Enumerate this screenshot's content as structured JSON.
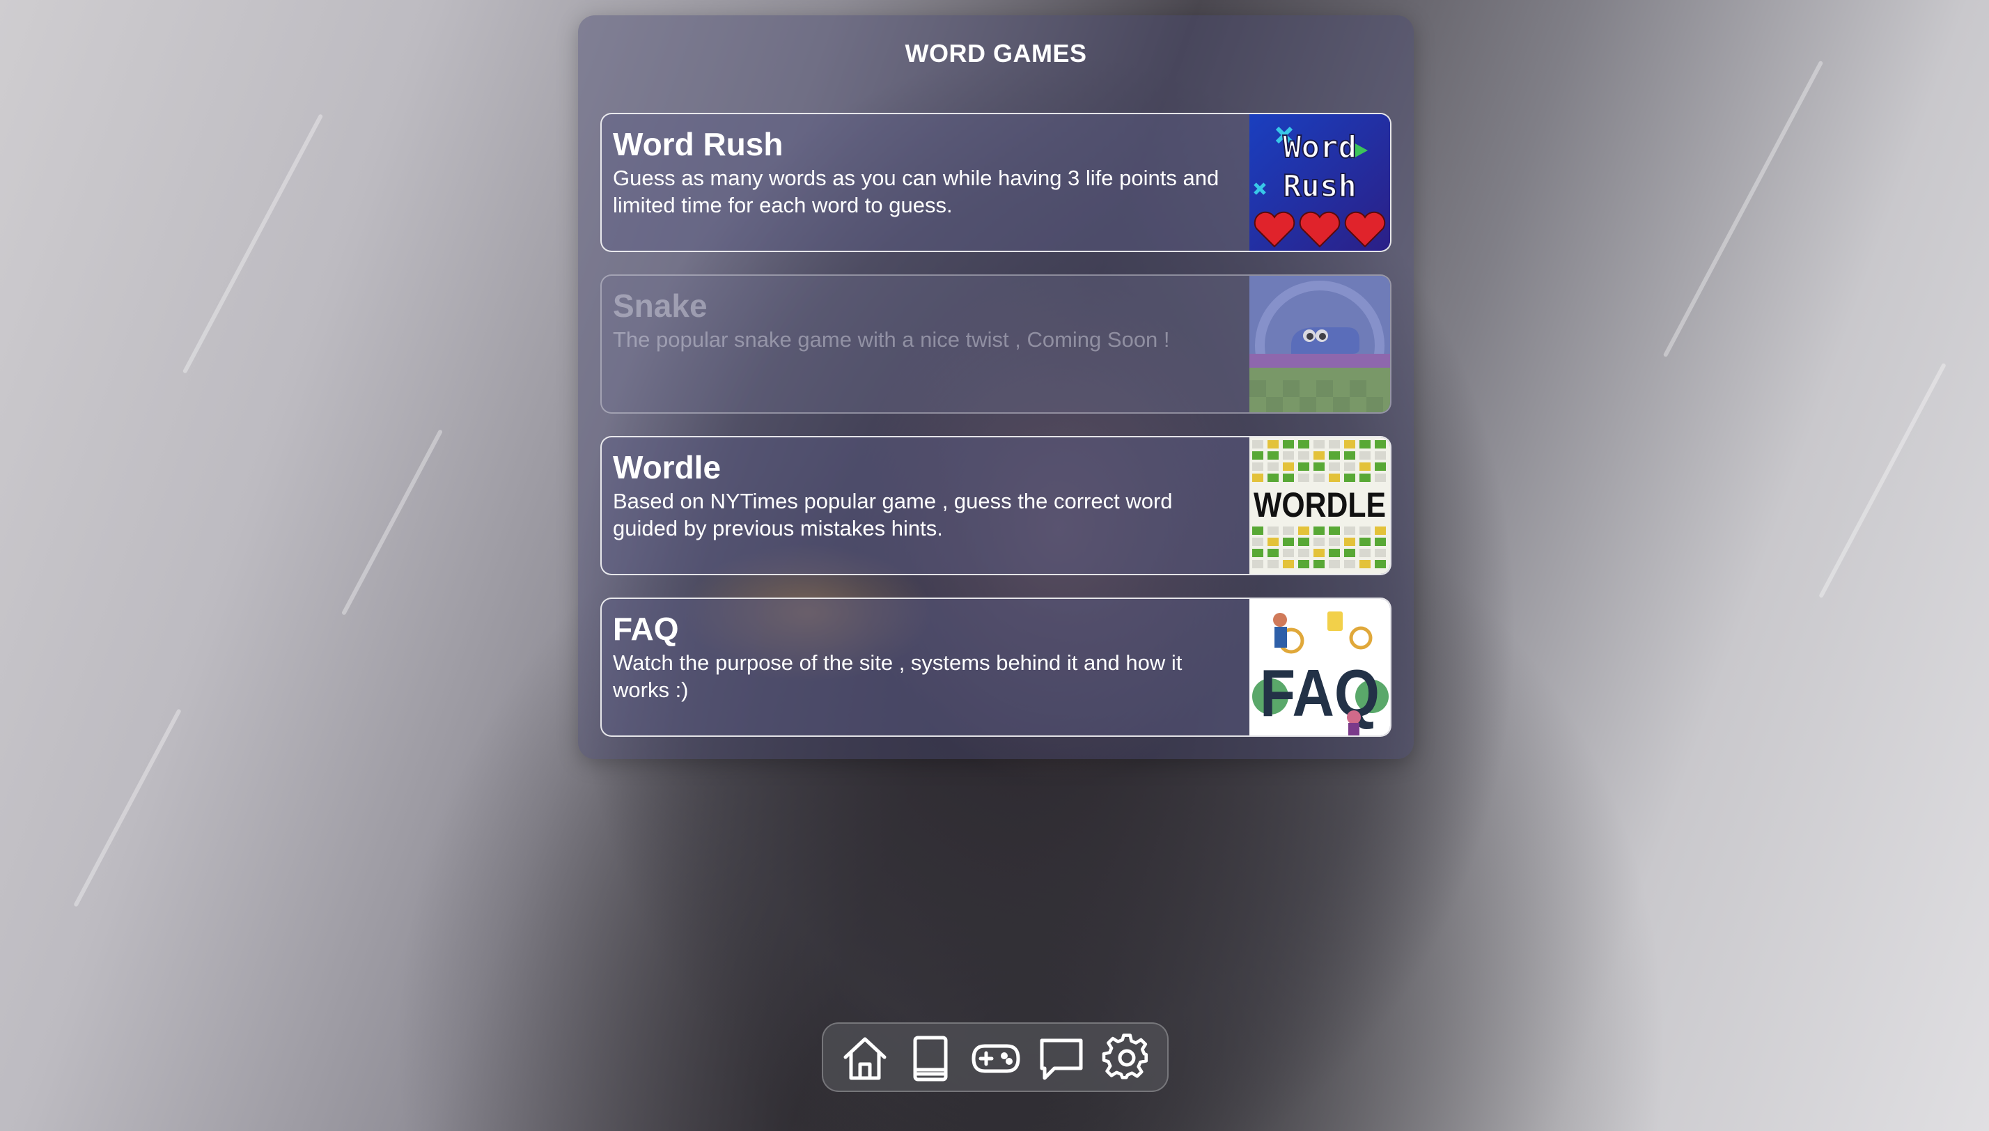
{
  "panel": {
    "title": "WORD GAMES"
  },
  "games": [
    {
      "title": "Word Rush",
      "description": "Guess as many words as you can while having 3 life points and limited time for each word to guess.",
      "thumbnail_text_line1": "Word",
      "thumbnail_text_line2": "Rush",
      "enabled": true
    },
    {
      "title": "Snake",
      "description": "The popular snake game with a nice twist , Coming Soon !",
      "enabled": false
    },
    {
      "title": "Wordle",
      "description": "Based on NYTimes popular game , guess the correct word guided by previous mistakes hints.",
      "thumbnail_text": "WORDLE",
      "enabled": true
    },
    {
      "title": "FAQ",
      "description": "Watch the purpose of the site , systems behind it and how it works :)",
      "thumbnail_text": "FAQ",
      "enabled": true
    }
  ],
  "dock": {
    "items": [
      {
        "icon": "home-icon"
      },
      {
        "icon": "book-icon"
      },
      {
        "icon": "gamepad-icon"
      },
      {
        "icon": "chat-icon"
      },
      {
        "icon": "settings-gear-icon"
      }
    ]
  },
  "colors": {
    "card_border": "#ffffff",
    "heart_red": "#e0232b",
    "wordle_green": "#58a835",
    "wordle_yellow": "#e3c23a"
  }
}
